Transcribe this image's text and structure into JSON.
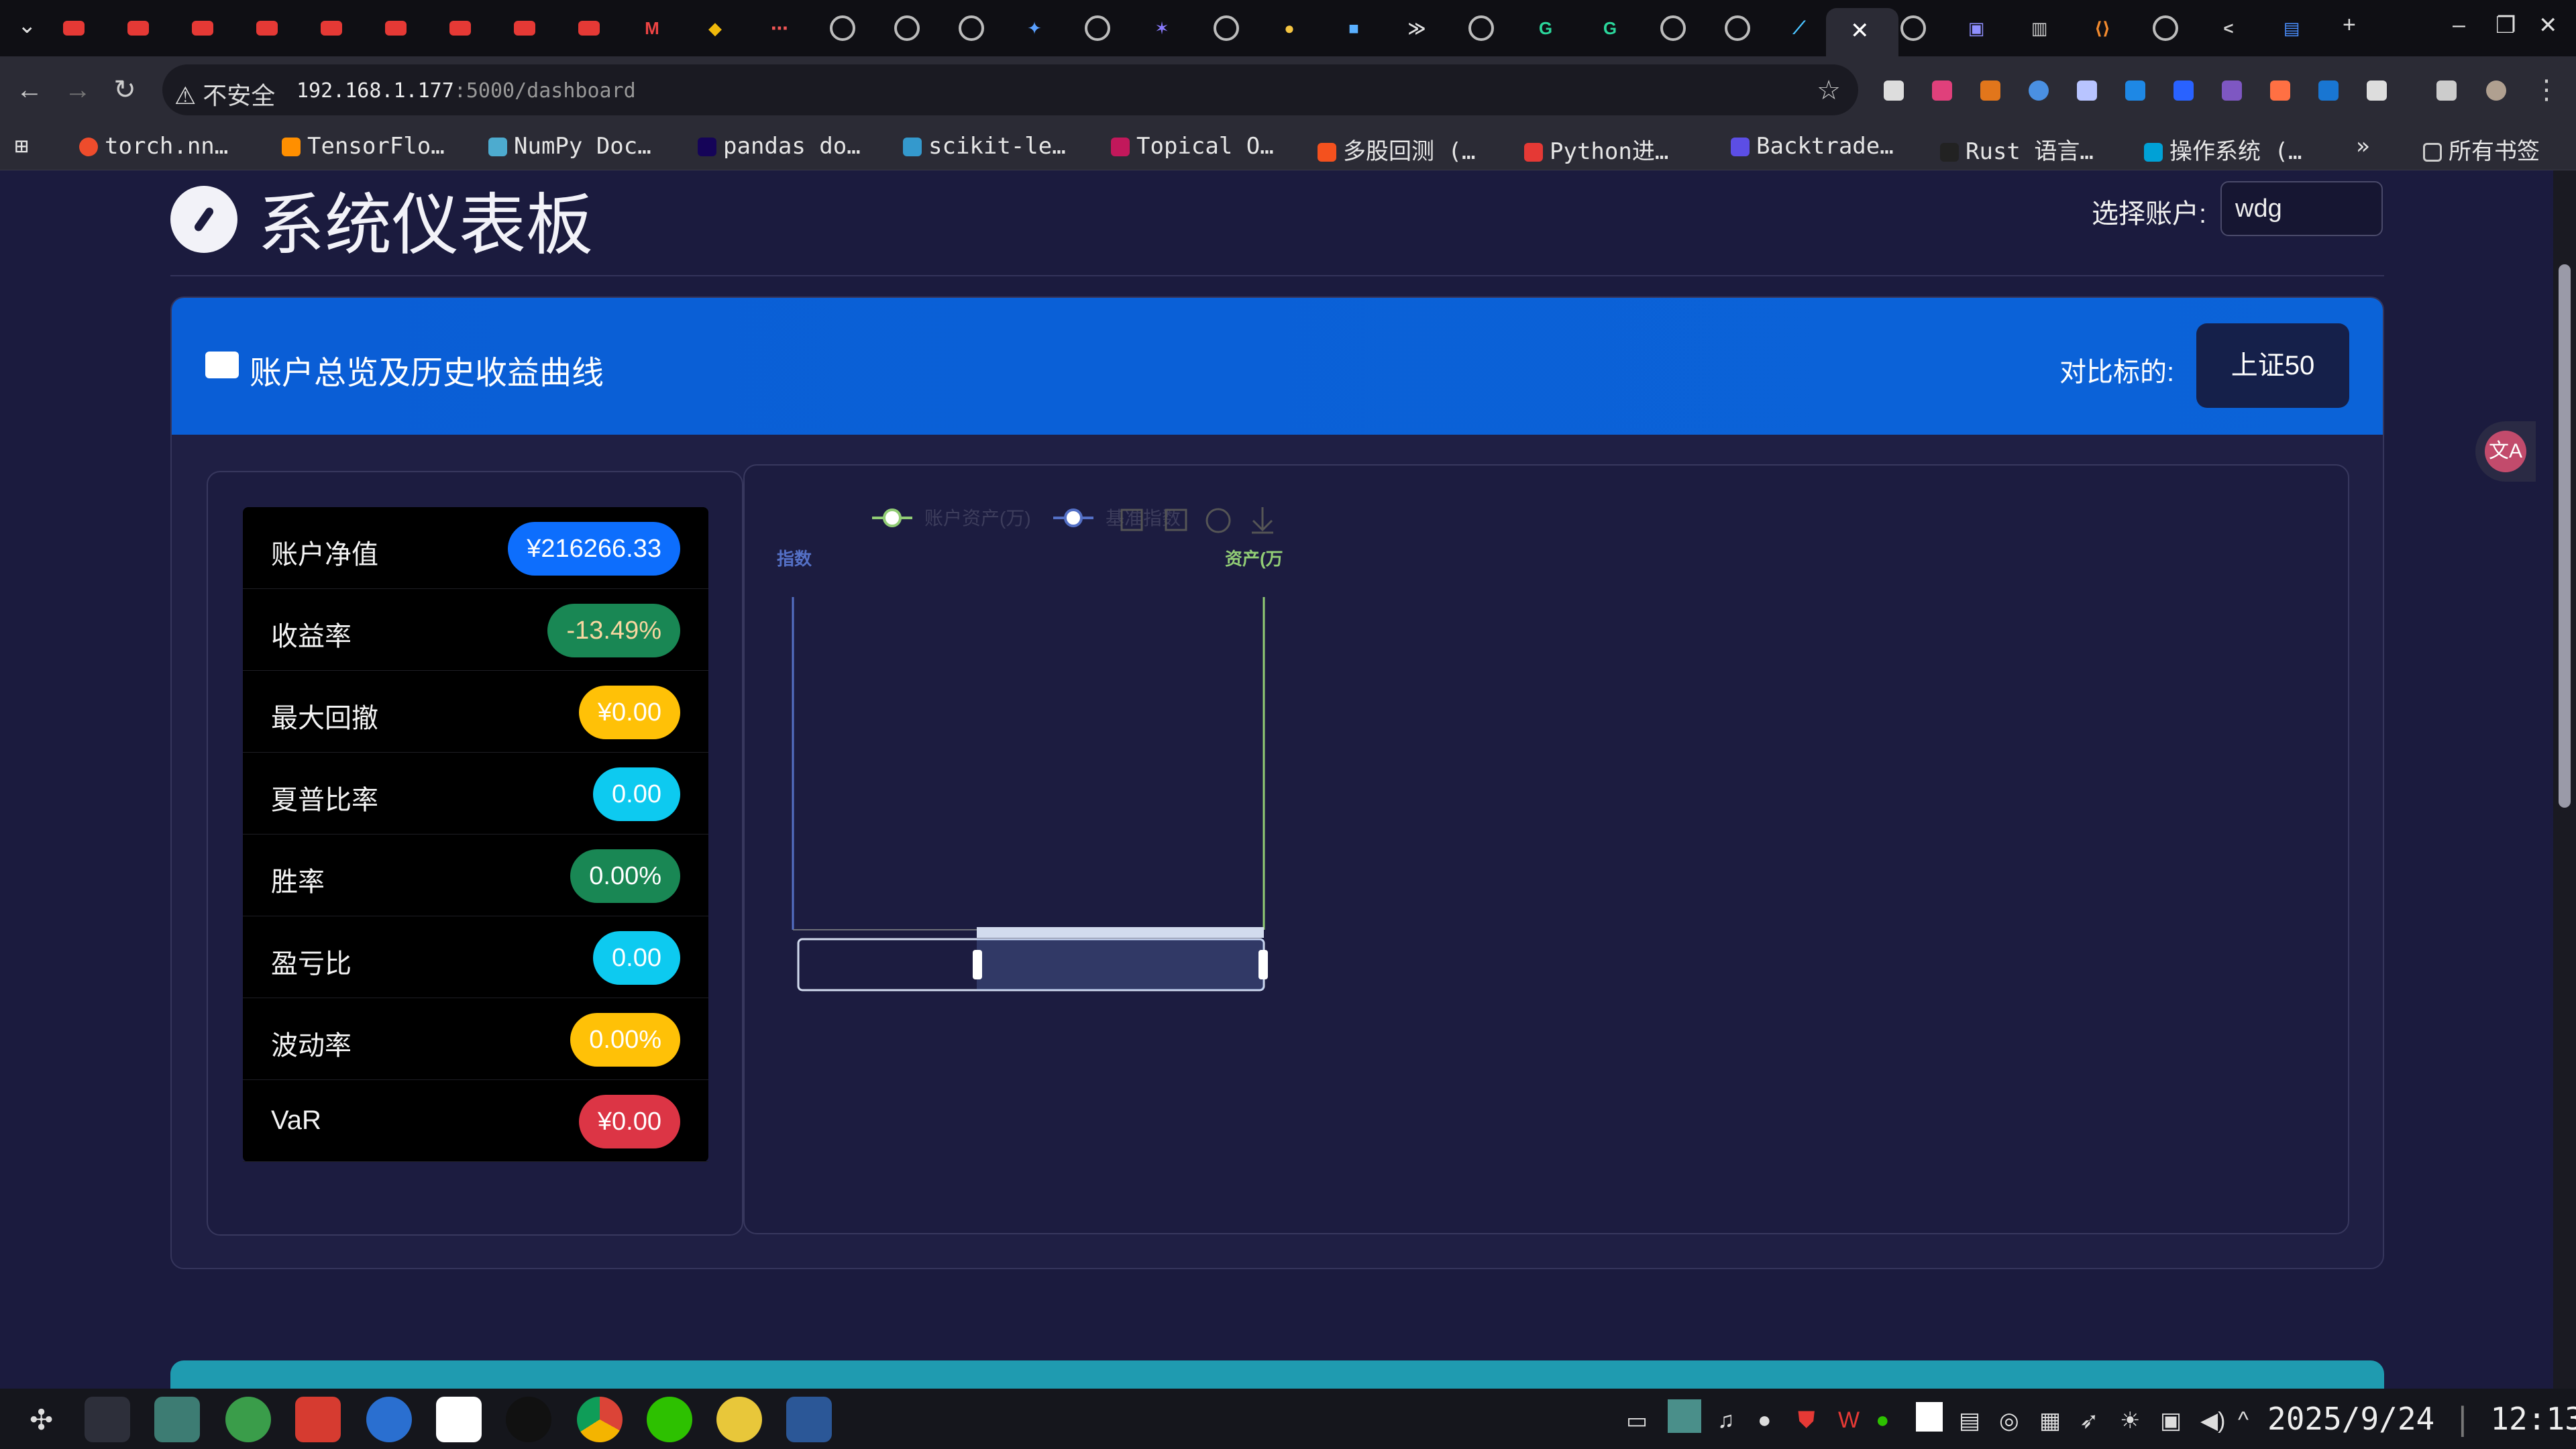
{
  "browser": {
    "security_label": "⚠ 不安全",
    "url_host": "192.168.1.177",
    "url_rest": ":5000/dashboard",
    "bookmarks": [
      "torch.nn…",
      "TensorFlo…",
      "NumPy Doc…",
      "pandas do…",
      "scikit-le…",
      "Topical O…",
      "多股回测 (…",
      "Python进…",
      "Backtrade…",
      "Rust 语言…",
      "操作系统 (…"
    ],
    "bookmarks_more": "»",
    "all_bookmarks": "所有书签"
  },
  "header": {
    "title": "系统仪表板",
    "account_label": "选择账户:",
    "account_value": "wdg"
  },
  "overview": {
    "title": "账户总览及历史收益曲线",
    "benchmark_label": "对比标的:",
    "benchmark_value": "上证50",
    "metrics": [
      {
        "label": "账户净值",
        "value": "¥216266.33",
        "color": "#0d6efd"
      },
      {
        "label": "收益率",
        "value": "-13.49%",
        "color": "#198754"
      },
      {
        "label": "最大回撤",
        "value": "¥0.00",
        "color": "#ffc107"
      },
      {
        "label": "夏普比率",
        "value": "0.00",
        "color": "#0dcaf0"
      },
      {
        "label": "胜率",
        "value": "0.00%",
        "color": "#198754"
      },
      {
        "label": "盈亏比",
        "value": "0.00",
        "color": "#0dcaf0"
      },
      {
        "label": "波动率",
        "value": "0.00%",
        "color": "#ffc107"
      },
      {
        "label": "VaR",
        "value": "¥0.00",
        "color": "#dc3545"
      }
    ]
  },
  "chart_data": {
    "type": "line",
    "series": [
      {
        "name": "账户资产(万)",
        "values": []
      },
      {
        "name": "基准指数",
        "values": []
      }
    ],
    "ylabel_left": "指数",
    "ylabel_right": "资产(万",
    "grid": false,
    "legend": "top-left"
  },
  "taskbar": {
    "date": "2025/9/24",
    "time": "12:13"
  }
}
